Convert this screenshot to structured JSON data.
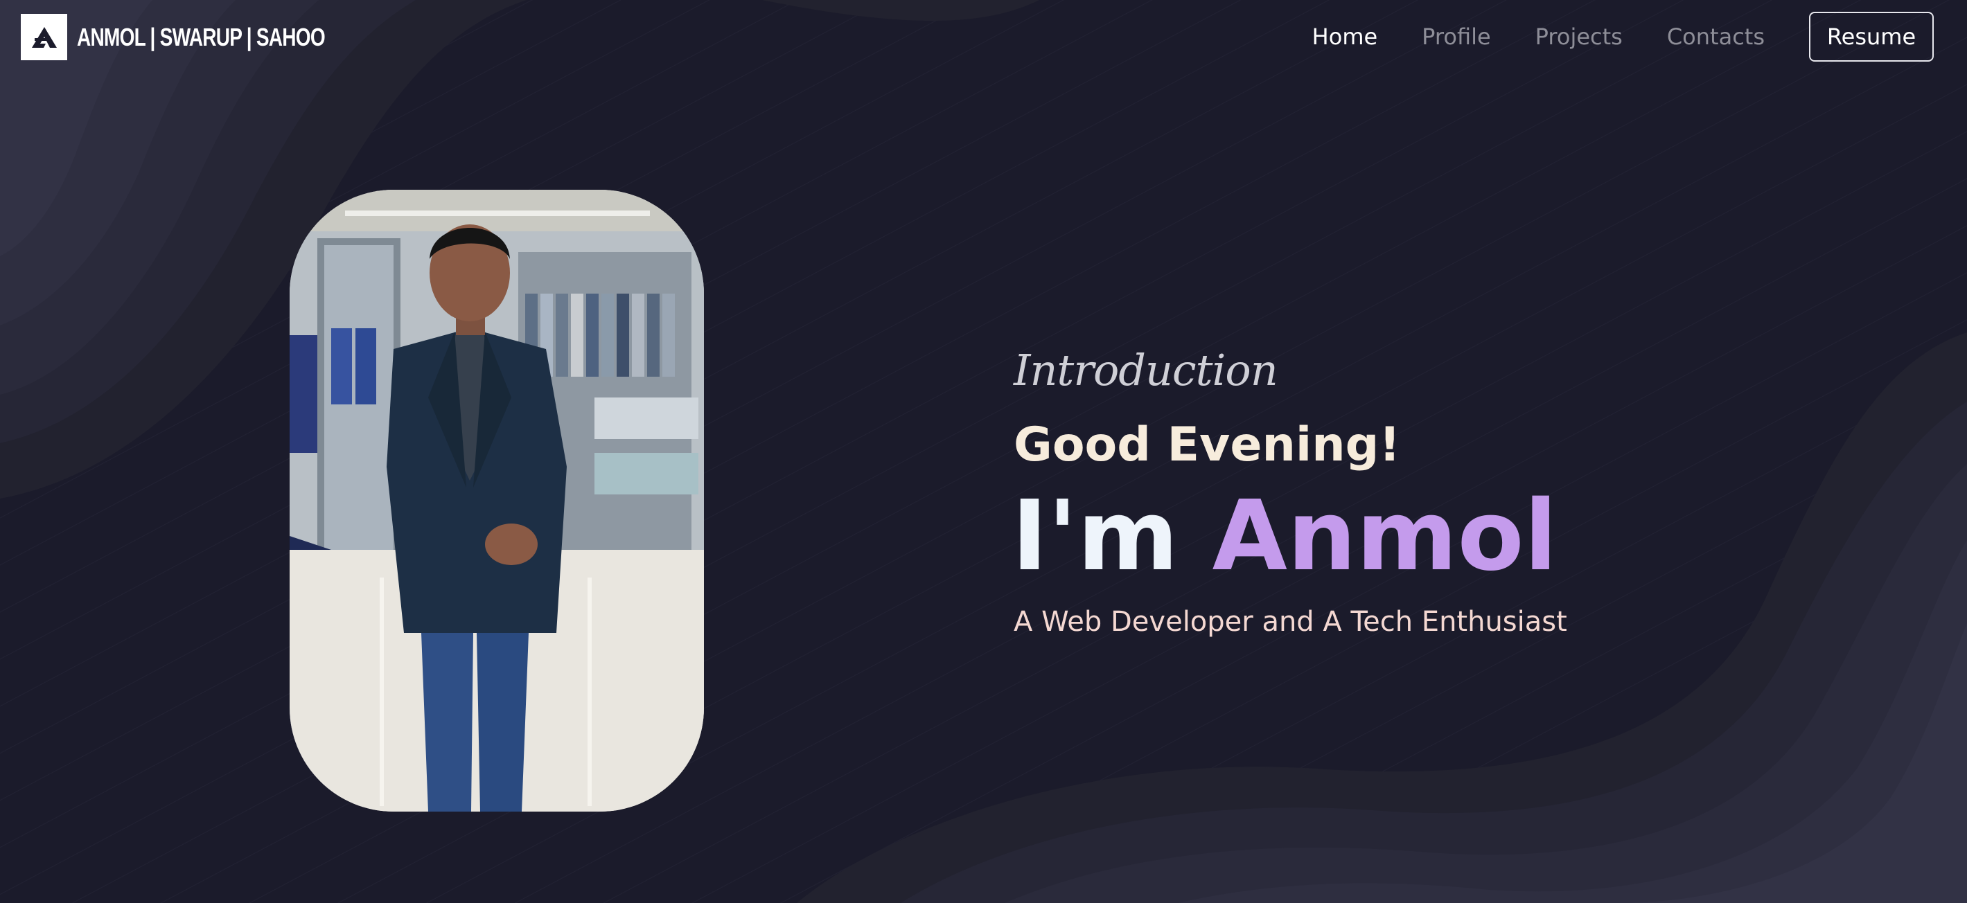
{
  "header": {
    "brand": "ANMOL | SWARUP | SAHOO",
    "logo_icon": "monogram-a-logo",
    "nav": {
      "home": "Home",
      "profile": "Profile",
      "projects": "Projects",
      "contacts": "Contacts",
      "active": "Home"
    },
    "resume_label": "Resume"
  },
  "hero": {
    "intro": "Introduction",
    "greeting": "Good Evening!",
    "name_prefix": "I'm ",
    "name": "Anmol",
    "tagline": "A Web Developer and A Tech Enthusiast",
    "photo_icon": "profile-photo"
  },
  "colors": {
    "background": "#1b1b2b",
    "accent": "#c49bec",
    "greeting": "#f7ecdc",
    "tagline": "#f4d8d2"
  }
}
